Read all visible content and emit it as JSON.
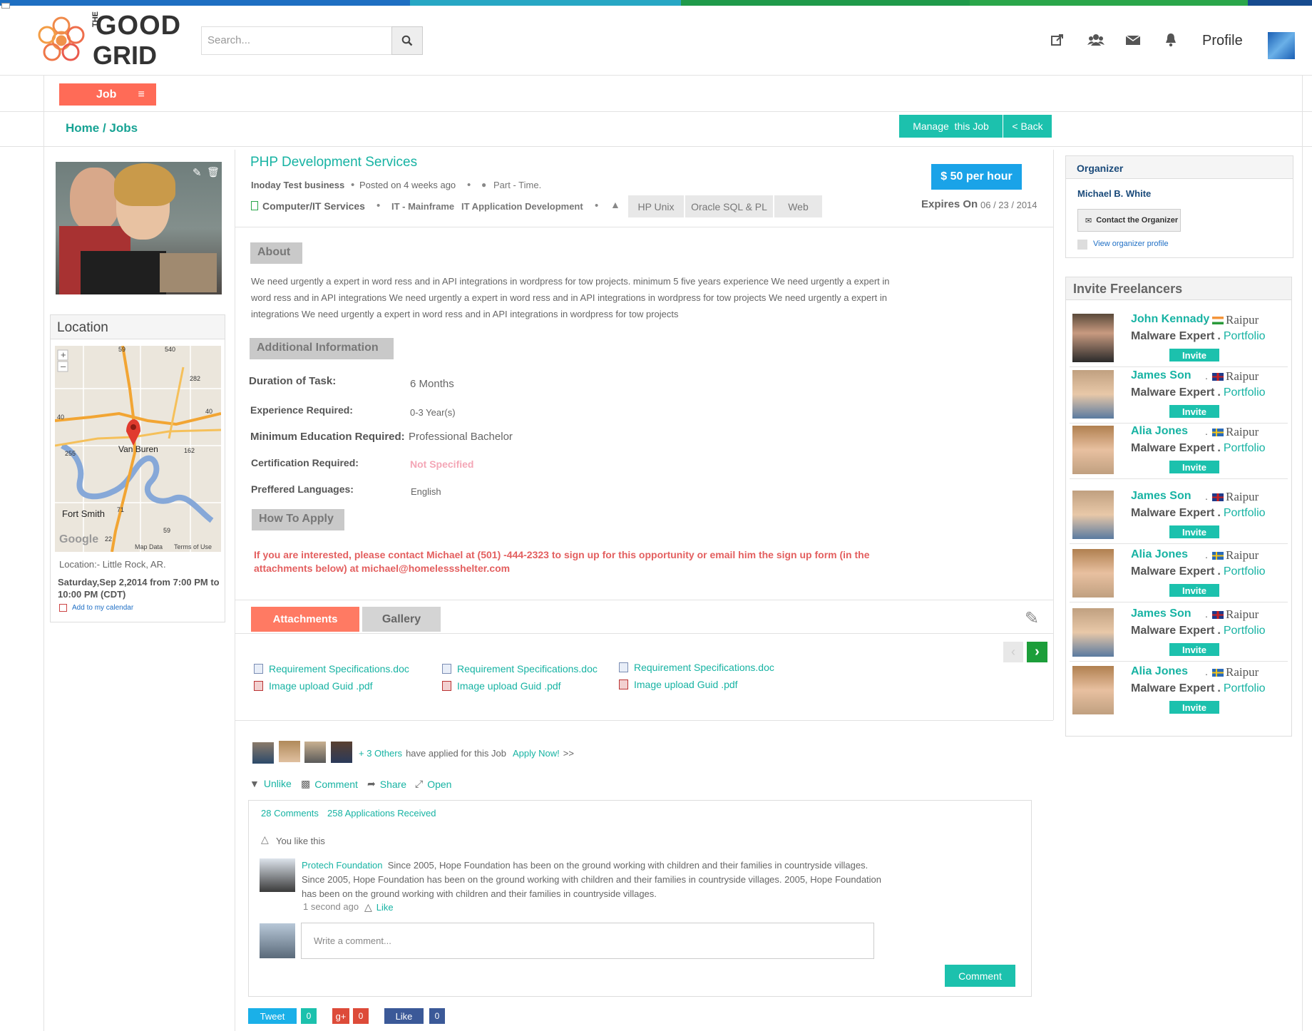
{
  "colors": {
    "accent": "#1cc1ad",
    "link": "#17b3a3",
    "coral": "#ff6b57",
    "danger": "#e06666"
  },
  "header": {
    "logo_text_top": "THE GOOD",
    "logo_text_bottom": "GRID",
    "search_placeholder": "Search...",
    "profile_label": "Profile",
    "icons": [
      "external-link-icon",
      "users-icon",
      "envelope-icon",
      "bell-icon",
      "search-icon"
    ]
  },
  "nav": {
    "job_tab": "Job",
    "breadcrumb": "Home / Jobs",
    "manage_btn": "Manage  this Job",
    "back_btn": "< Back"
  },
  "left": {
    "location_title": "Location",
    "map_labels": {
      "city1": "Van Buren",
      "city2": "Fort Smith",
      "google": "Google",
      "map_data": "Map Data",
      "terms": "Terms of Use",
      "roads": [
        "59",
        "540",
        "282",
        "40",
        "40",
        "255",
        "162",
        "71",
        "22",
        "59"
      ]
    },
    "location_text": "Location:- Little Rock, AR.",
    "date_text": "Saturday,Sep 2,2014 from 7:00 PM to 10:00 PM  (CDT)",
    "calendar_link": "Add to my calendar"
  },
  "job": {
    "title": "PHP Development Services",
    "business": "Inoday Test business",
    "posted": "Posted on 4 weeks ago",
    "type": "Part - Time.",
    "category": "Computer/IT Services",
    "sub1": "IT - Mainframe",
    "sub2": "IT Application Development",
    "tags": [
      "HP Unix",
      "Oracle SQL & PL",
      "Web"
    ],
    "rate": "$ 50 per hour",
    "expires_label": "Expires On",
    "expires_date": "06 / 23 / 2014",
    "about_title": "About",
    "about_text": "We need urgently a expert in word ress and in API integrations in wordpress for tow projects. minimum 5 five years experience We need urgently a expert in word ress and in API integrations We need urgently a expert in word ress and in API integrations in wordpress for tow projects We need urgently a expert in integrations We need urgently a expert in word ress and in API integrations in wordpress for tow projects",
    "additional_title": "Additional Information",
    "info": [
      {
        "label": "Duration of Task:",
        "value": "6 Months"
      },
      {
        "label": "Experience Required:",
        "value": "0-3 Year(s)"
      },
      {
        "label": "Minimum  Education Required:",
        "value": "Professional Bachelor"
      },
      {
        "label": "Certification Required:",
        "value": "Not Specified"
      },
      {
        "label": "Preffered Languages:",
        "value": "English"
      }
    ],
    "how_title": "How To Apply",
    "how_text": "If you are interested, please contact Michael at (501) -444-2323 to sign up for this opportunity or email him the sign up form (in the attachments below) at michael@homelessshelter.com"
  },
  "attachments": {
    "tab_active": "Attachments",
    "tab_inactive": "Gallery",
    "files": [
      {
        "doc": "Requirement Specifications.doc",
        "pdf": "Image upload Guid .pdf"
      },
      {
        "doc": "Requirement Specifications.doc",
        "pdf": "Image upload Guid .pdf"
      },
      {
        "doc": "Requirement Specifications.doc",
        "pdf": "Image upload Guid .pdf"
      }
    ]
  },
  "social": {
    "applied_others": "+ 3 Others",
    "applied_text": "have applied for this  Job",
    "apply_now": "Apply Now!",
    "apply_arrows": ">>",
    "actions": [
      "Unlike",
      "Comment",
      "Share",
      "Open"
    ],
    "comments_count": "28 Comments",
    "applications_count": "258 Applications Received",
    "you_like": "You like this",
    "comment_author": "Protech Foundation",
    "comment_text": "Since 2005, Hope Foundation has been on the ground working with children and their families in countryside villages. Since 2005, Hope Foundation has been on the ground working with children and their families in countryside villages. 2005, Hope Foundation has been on the ground working with children and their families in countryside villages.",
    "comment_time": "1 second ago",
    "comment_like": "Like",
    "comment_placeholder": "Write a comment...",
    "comment_btn": "Comment",
    "share_buttons": [
      {
        "label": "Tweet",
        "count": "0"
      },
      {
        "label": "g+",
        "count": "0"
      },
      {
        "label": "Like",
        "count": "0"
      }
    ]
  },
  "organizer": {
    "title": "Organizer",
    "name": "Michael B. White",
    "contact_btn": "Contact the Organizer",
    "view_profile": "View organizer profile"
  },
  "invite": {
    "title": "Invite Freelancers",
    "invite_label": "Invite",
    "role": "Malware Expert",
    "portfolio": "Portfolio",
    "freelancers": [
      {
        "name": "John Kennady",
        "city": "Raipur",
        "flag": "india"
      },
      {
        "name": "James Son",
        "city": "Raipur",
        "flag": "uk"
      },
      {
        "name": "Alia Jones",
        "city": "Raipur",
        "flag": "sweden"
      },
      {
        "name": "James Son",
        "city": "Raipur",
        "flag": "uk"
      },
      {
        "name": "Alia Jones",
        "city": "Raipur",
        "flag": "sweden"
      },
      {
        "name": "James Son",
        "city": "Raipur",
        "flag": "uk"
      },
      {
        "name": "Alia Jones",
        "city": "Raipur",
        "flag": "sweden"
      }
    ]
  }
}
